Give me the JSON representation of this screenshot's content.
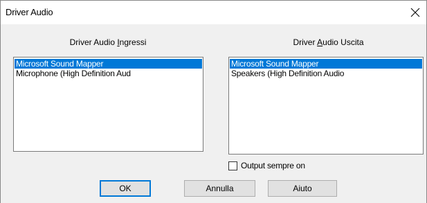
{
  "window": {
    "title": "Driver Audio",
    "close_glyph": "close-icon"
  },
  "inputs": {
    "label_pre": "Driver Audio ",
    "label_accel": "I",
    "label_post": "ngressi",
    "items": [
      "Microsoft Sound Mapper",
      "Microphone (High Definition Aud"
    ],
    "selected_index": 0
  },
  "outputs": {
    "label_pre": "Driver ",
    "label_accel": "A",
    "label_post": "udio Uscita",
    "items": [
      "Microsoft Sound Mapper",
      "Speakers (High Definition Audio"
    ],
    "selected_index": 0
  },
  "options": {
    "output_always_on_label": "Output sempre on",
    "output_always_on_checked": false
  },
  "buttons": {
    "ok": "OK",
    "cancel": "Annulla",
    "help": "Aiuto"
  },
  "colors": {
    "selection": "#0078d7",
    "dialog_bg": "#f0f0f0",
    "default_button_border": "#0078d7"
  }
}
